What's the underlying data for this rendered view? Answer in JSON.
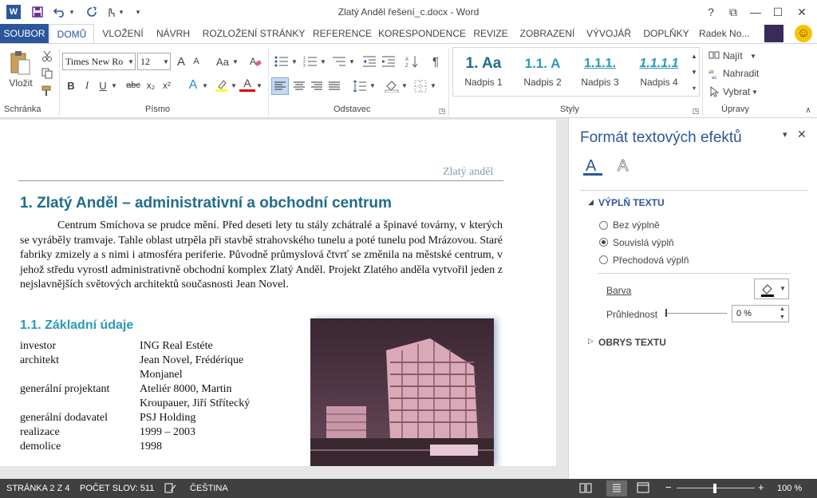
{
  "window": {
    "title": "Zlatý Anděl řešení_c.docx - Word",
    "help": "?",
    "ribbon_opts": "⧉",
    "minimize": "—",
    "maximize": "☐",
    "close": "✕"
  },
  "qat": {
    "word_icon": "W",
    "undo_caret": "▾",
    "custom_caret": "▾"
  },
  "menu": {
    "file": "SOUBOR",
    "tabs": [
      "DOMŮ",
      "VLOŽENÍ",
      "NÁVRH",
      "ROZLOŽENÍ STRÁNKY",
      "REFERENCE",
      "KORESPONDENCE",
      "REVIZE",
      "ZOBRAZENÍ",
      "VÝVOJÁŘ",
      "DOPLŇKY"
    ],
    "user": "Radek No...",
    "smiley": "☺"
  },
  "ribbon": {
    "paste_label": "Vložit",
    "clipboard_group": "Schránka",
    "font_group": "Písmo",
    "paragraph_group": "Odstavec",
    "styles_group": "Styly",
    "editing_group": "Úpravy",
    "font_name": "Times New Ro",
    "font_size": "12",
    "grow_font": "A",
    "shrink_font": "A",
    "change_case": "Aa",
    "bold": "B",
    "italic": "I",
    "underline": "U",
    "strike": "abc",
    "subscript": "x₂",
    "superscript": "x²",
    "effects": "A",
    "font_color": "A",
    "pilcrow": "¶",
    "styles": [
      {
        "preview": "1.  Aa",
        "label": "Nadpis 1"
      },
      {
        "preview": "1.1.  A",
        "label": "Nadpis 2"
      },
      {
        "preview": "1.1.1.",
        "label": "Nadpis 3"
      },
      {
        "preview": "1.1.1.1",
        "label": "Nadpis 4"
      }
    ],
    "find": "Najít",
    "replace": "Nahradit",
    "select": "Vybrat"
  },
  "document": {
    "header": "Zlatý anděl",
    "heading1": "1.  Zlatý Anděl – administrativní a obchodní centrum",
    "paragraph": "Centrum Smíchova se prudce mění. Před deseti lety tu stály zchátralé a špinavé továrny, v kterých se vyráběly tramvaje. Tahle oblast utrpěla při stavbě strahovského tunelu a poté tunelu pod Mrázovou. Staré fabriky zmizely a s nimi i atmosféra periferie. Původně průmyslová čtvrť se změnila na městské centrum, v jehož středu vyrostl administrativně obchodní komplex Zlatý Anděl. Projekt Zlatého anděla vytvořil jeden z nejslavnějších světových architektů současnosti Jean Novel.",
    "heading2": "1.1. Základní údaje",
    "rows": [
      {
        "key": "investor",
        "value": "ING Real Estéte"
      },
      {
        "key": "architekt",
        "value": "Jean Novel, Frédérique Monjanel"
      },
      {
        "key": "generální projektant",
        "value": "Ateliér 8000, Martin Kroupauer, Jiří Střítecký"
      },
      {
        "key": "generální dodavatel",
        "value": "PSJ Holding"
      },
      {
        "key": "realizace",
        "value": "1999 – 2003"
      },
      {
        "key": "demolice",
        "value": "1998"
      }
    ]
  },
  "pane": {
    "title": "Formát textových efektů",
    "fill_section": "VÝPLŇ TEXTU",
    "options": [
      "Bez výplně",
      "Souvislá výplň",
      "Přechodová výplň"
    ],
    "selected_option": 1,
    "color_label": "Barva",
    "transparency_label": "Průhlednost",
    "transparency_value": "0 %",
    "outline_section": "OBRYS TEXTU",
    "pin": "▾",
    "close": "✕"
  },
  "status": {
    "page": "STRÁNKA 2 Z 4",
    "words": "POČET SLOV: 511",
    "language": "ČEŠTINA",
    "zoom_out": "−",
    "zoom_in": "+",
    "zoom": "100 %"
  },
  "colors": {
    "accent": "#2b579a",
    "heading": "#1f6d8c",
    "status_bg": "#404040"
  }
}
